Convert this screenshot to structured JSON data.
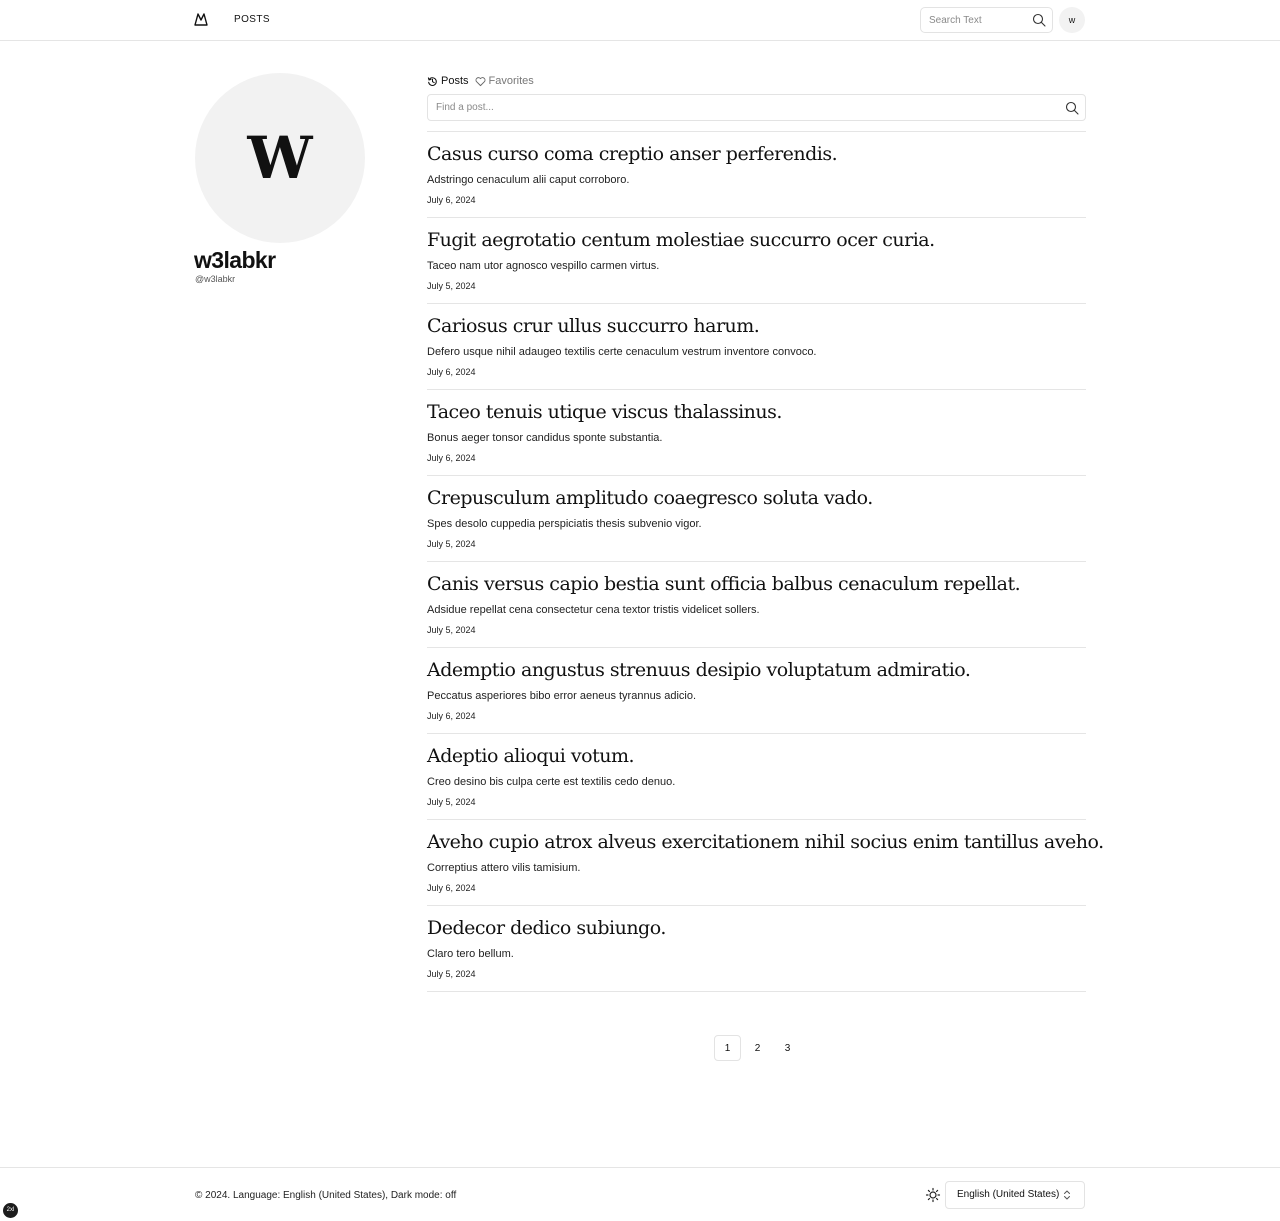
{
  "header": {
    "logo": "mountain-logo-icon",
    "nav_posts": "POSTS",
    "search_placeholder": "Search Text",
    "user_initial": "w"
  },
  "profile": {
    "avatar_letter": "W",
    "name": "w3labkr",
    "handle": "@w3labkr"
  },
  "tabs": [
    {
      "label": "Posts",
      "icon": "history-icon"
    },
    {
      "label": "Favorites",
      "icon": "heart-icon"
    }
  ],
  "post_search": {
    "placeholder": "Find a post..."
  },
  "posts": [
    {
      "title": "Casus curso coma creptio anser perferendis.",
      "excerpt": "Adstringo cenaculum alii caput corroboro.",
      "date": "July 6, 2024"
    },
    {
      "title": "Fugit aegrotatio centum molestiae succurro ocer curia.",
      "excerpt": "Taceo nam utor agnosco vespillo carmen virtus.",
      "date": "July 5, 2024"
    },
    {
      "title": "Cariosus crur ullus succurro harum.",
      "excerpt": "Defero usque nihil adaugeo textilis certe cenaculum vestrum inventore convoco.",
      "date": "July 6, 2024"
    },
    {
      "title": "Taceo tenuis utique viscus thalassinus.",
      "excerpt": "Bonus aeger tonsor candidus sponte substantia.",
      "date": "July 6, 2024"
    },
    {
      "title": "Crepusculum amplitudo coaegresco soluta vado.",
      "excerpt": "Spes desolo cuppedia perspiciatis thesis subvenio vigor.",
      "date": "July 5, 2024"
    },
    {
      "title": "Canis versus capio bestia sunt officia balbus cenaculum repellat.",
      "excerpt": "Adsidue repellat cena consectetur cena textor tristis videlicet sollers.",
      "date": "July 5, 2024"
    },
    {
      "title": "Ademptio angustus strenuus desipio voluptatum admiratio.",
      "excerpt": "Peccatus asperiores bibo error aeneus tyrannus adicio.",
      "date": "July 6, 2024"
    },
    {
      "title": "Adeptio alioqui votum.",
      "excerpt": "Creo desino bis culpa certe est textilis cedo denuo.",
      "date": "July 5, 2024"
    },
    {
      "title": "Aveho cupio atrox alveus exercitationem nihil socius enim tantillus aveho.",
      "excerpt": "Correptius attero vilis tamisium.",
      "date": "July 6, 2024"
    },
    {
      "title": "Dedecor dedico subiungo.",
      "excerpt": "Claro tero bellum.",
      "date": "July 5, 2024"
    }
  ],
  "pagination": {
    "pages": [
      "1",
      "2",
      "3"
    ],
    "current": "1"
  },
  "footer": {
    "text": "© 2024. Language: English (United States), Dark mode: off",
    "theme_icon": "sun-icon",
    "language_selected": "English (United States)"
  },
  "corner_badge": "2xl",
  "colors": {
    "text": "#111111",
    "border": "#e5e5e5",
    "avatar_bg": "#f2f2f2",
    "muted": "#777777"
  }
}
